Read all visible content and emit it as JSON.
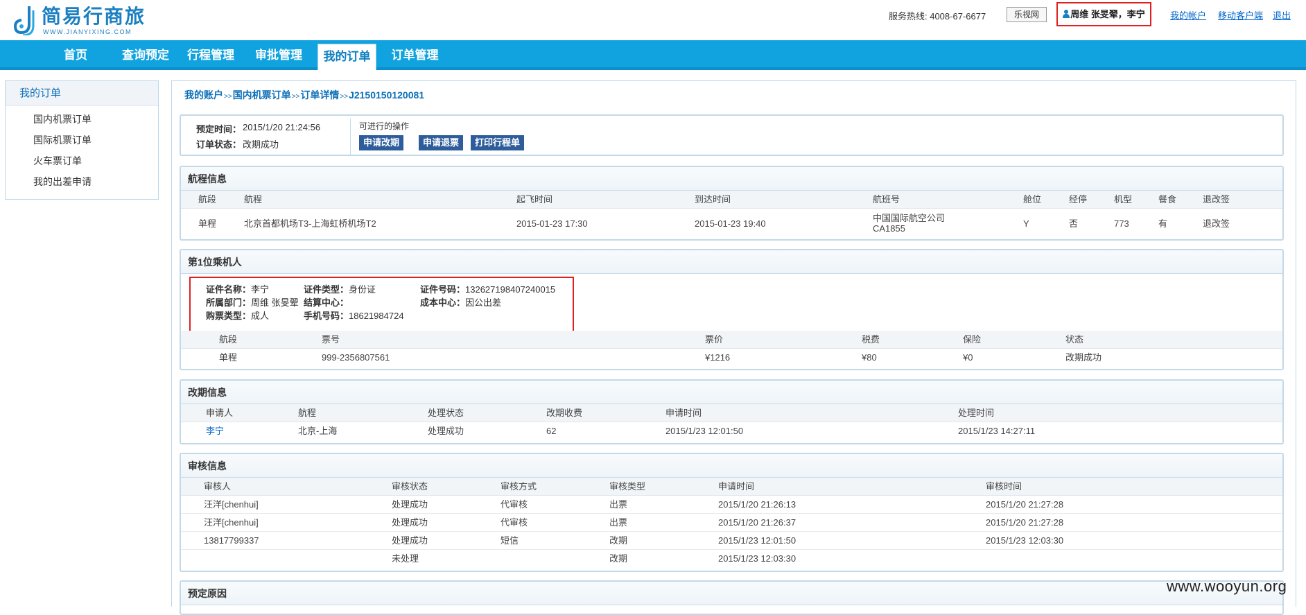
{
  "header": {
    "logo_text": "简易行商旅",
    "logo_domain": "WWW.JIANYIXING.COM",
    "hotline": "服务热线: 4008-67-6677",
    "leshi_button": "乐视网",
    "user_display": "周维 张旻翚，李宁",
    "links": {
      "account": "我的帐户",
      "mobile": "移动客户端",
      "logout": "退出"
    }
  },
  "nav": {
    "items": [
      "首页",
      "查询预定",
      "行程管理",
      "审批管理",
      "我的订单",
      "订单管理"
    ],
    "active": "我的订单"
  },
  "sidebar": {
    "title": "我的订单",
    "items": [
      "国内机票订单",
      "国际机票订单",
      "火车票订单",
      "我的出差申请"
    ]
  },
  "breadcrumb": {
    "items": [
      "我的账户",
      "国内机票订单",
      "订单详情",
      "J2150150120081"
    ],
    "separator": ">>"
  },
  "order": {
    "time_label": "预定时间：",
    "time_value": "2015/1/20 21:24:56",
    "status_label": "订单状态：",
    "status_value": "改期成功",
    "ops_label": "可进行的操作",
    "buttons": [
      "申请改期",
      "申请退票",
      "打印行程单"
    ]
  },
  "flight": {
    "title": "航程信息",
    "headers": [
      "航段",
      "航程",
      "起飞时间",
      "到达时间",
      "航班号",
      "舱位",
      "经停",
      "机型",
      "餐食",
      "退改签"
    ],
    "row": {
      "segment": "单程",
      "route": "北京首都机场T3-上海虹桥机场T2",
      "depart": "2015-01-23 17:30",
      "arrive": "2015-01-23 19:40",
      "airline": "中国国际航空公司",
      "flight_no": "CA1855",
      "cabin": "Y",
      "stop": "否",
      "aircraft": "773",
      "meal": "有",
      "refund": "退改签"
    }
  },
  "passenger": {
    "title": "第1位乘机人",
    "fields": {
      "name_label": "证件名称：",
      "name_value": "李宁",
      "idtype_label": "证件类型：",
      "idtype_value": "身份证",
      "idno_label": "证件号码：",
      "idno_value": "132627198407240015",
      "dept_label": "所属部门：",
      "dept_value": "周维 张旻翚",
      "settle_label": "结算中心：",
      "settle_value": "",
      "cost_label": "成本中心：",
      "cost_value": "因公出差",
      "ticket_type_label": "购票类型：",
      "ticket_type_value": "成人",
      "phone_label": "手机号码：",
      "phone_value": "18621984724"
    },
    "ticket_headers": [
      "航段",
      "票号",
      "票价",
      "税费",
      "保险",
      "状态"
    ],
    "ticket_row": [
      "单程",
      "999-2356807561",
      "¥1216",
      "¥80",
      "¥0",
      "改期成功"
    ]
  },
  "reschedule": {
    "title": "改期信息",
    "headers": [
      "申请人",
      "航程",
      "处理状态",
      "改期收费",
      "申请时间",
      "处理时间"
    ],
    "row": [
      "李宁",
      "北京-上海",
      "处理成功",
      "62",
      "2015/1/23 12:01:50",
      "2015/1/23 14:27:11"
    ]
  },
  "audit": {
    "title": "审核信息",
    "headers": [
      "审核人",
      "审核状态",
      "审核方式",
      "审核类型",
      "申请时间",
      "审核时间"
    ],
    "rows": [
      [
        "汪洋[chenhui]",
        "处理成功",
        "代审核",
        "出票",
        "2015/1/20 21:26:13",
        "2015/1/20 21:27:28"
      ],
      [
        "汪洋[chenhui]",
        "处理成功",
        "代审核",
        "出票",
        "2015/1/20 21:26:37",
        "2015/1/20 21:27:28"
      ],
      [
        "13817799337",
        "处理成功",
        "短信",
        "改期",
        "2015/1/23 12:01:50",
        "2015/1/23 12:03:30"
      ],
      [
        "",
        "未处理",
        "",
        "改期",
        "2015/1/23 12:03:30",
        ""
      ]
    ]
  },
  "reason": {
    "title": "预定原因"
  },
  "watermark": "www.wooyun.org",
  "colors": {
    "nav": "#11a3e0",
    "button": "#2e5d9c",
    "highlight_border": "#e02020",
    "link": "#0066cc"
  }
}
